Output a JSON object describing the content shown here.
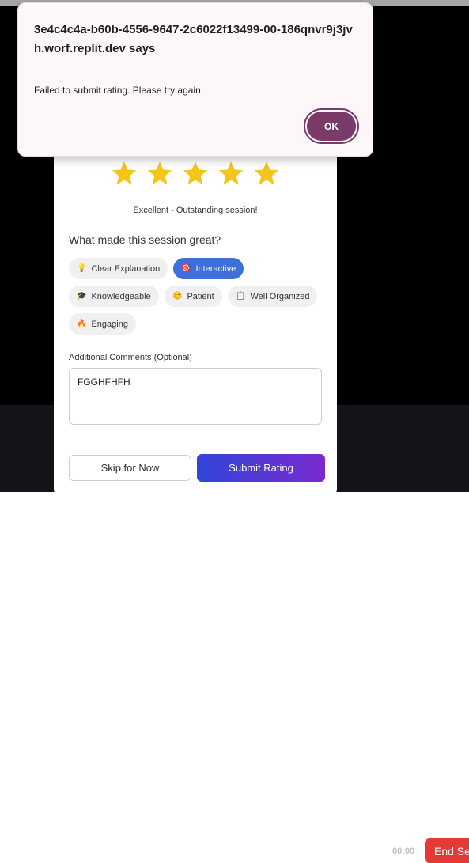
{
  "background": {
    "timer": "00:00",
    "end_button": "End Se"
  },
  "rating_modal": {
    "stars_filled": 5,
    "stars_total": 5,
    "rating_text": "Excellent - Outstanding session!",
    "question": "What made this session great?",
    "tags": [
      {
        "emoji": "💡",
        "label": "Clear Explanation",
        "selected": false
      },
      {
        "emoji": "🎯",
        "label": "Interactive",
        "selected": true
      },
      {
        "emoji": "🎓",
        "label": "Knowledgeable",
        "selected": false
      },
      {
        "emoji": "😊",
        "label": "Patient",
        "selected": false
      },
      {
        "emoji": "📋",
        "label": "Well Organized",
        "selected": false
      },
      {
        "emoji": "🔥",
        "label": "Engaging",
        "selected": false
      }
    ],
    "comments_label": "Additional Comments (Optional)",
    "comments_value": "FGGHFHFH",
    "skip_button": "Skip for Now",
    "submit_button": "Submit Rating"
  },
  "alert": {
    "origin": "3e4c4c4a-b60b-4556-9647-2c6022f13499-00-186qnvr9j3jvh.worf.replit.dev says",
    "message": "Failed to submit rating. Please try again.",
    "ok_button": "OK"
  },
  "colors": {
    "star": "#f5c518",
    "selected_tag": "#3f6fd8",
    "submit_gradient_start": "#3046d8",
    "submit_gradient_end": "#7a2ad0",
    "ok_button": "#7b3b6a",
    "end_button": "#e53935"
  }
}
